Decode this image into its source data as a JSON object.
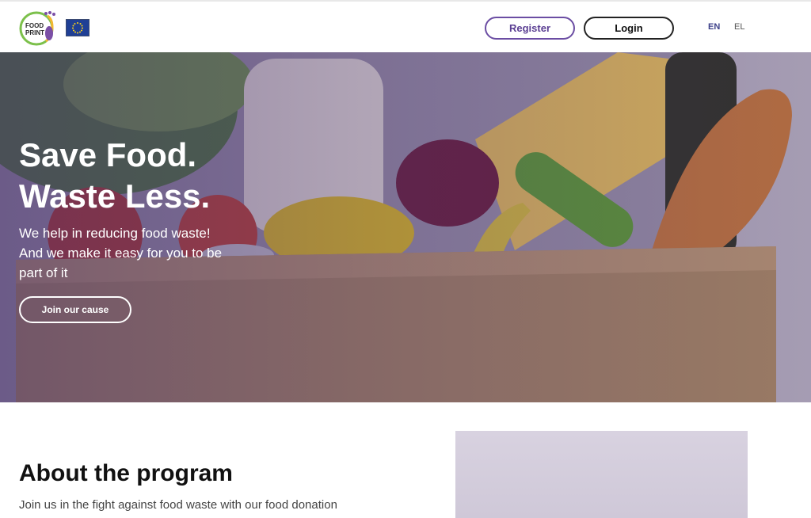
{
  "header": {
    "logo_lines": [
      "FOOD",
      "PRINT"
    ],
    "register_label": "Register",
    "login_label": "Login",
    "languages": [
      "EN",
      "EL"
    ],
    "active_language": "EN"
  },
  "hero": {
    "title_line1": "Save Food.",
    "title_line2": "Waste Less.",
    "subtitle": "We help in reducing food waste! And we make it easy for you to be part of it",
    "cta_label": "Join our cause"
  },
  "about": {
    "title": "About the program",
    "text": "Join us in the fight against food waste with our food donation"
  },
  "colors": {
    "brand_purple": "#6b4da3",
    "hero_overlay": "#462d6e",
    "eu_blue": "#1f3f95"
  },
  "icons": [
    "foodprint-logo-icon",
    "eu-flag-icon"
  ]
}
